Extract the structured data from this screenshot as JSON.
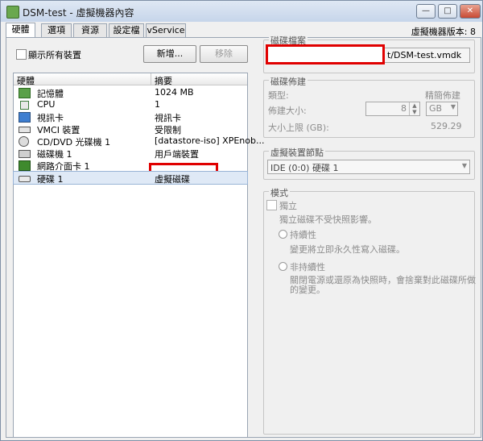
{
  "window": {
    "title": "DSM-test - 虛擬機器內容",
    "version": "虛擬機器版本: 8"
  },
  "tabs": [
    "硬體",
    "選項",
    "資源",
    "設定檔",
    "vService"
  ],
  "hardware": {
    "show_all_label": "顯示所有裝置",
    "add_label": "新增...",
    "remove_label": "移除",
    "col_hardware": "硬體",
    "col_summary": "摘要",
    "items": [
      {
        "icon": "memory-icon",
        "name": "記憶體",
        "summary": "1024 MB"
      },
      {
        "icon": "cpu-icon",
        "name": "CPU",
        "summary": "1"
      },
      {
        "icon": "display-icon",
        "name": "視訊卡",
        "summary": "視訊卡"
      },
      {
        "icon": "vmci-icon",
        "name": "VMCI 裝置",
        "summary": "受限制"
      },
      {
        "icon": "cd-icon",
        "name": "CD/DVD 光碟機 1",
        "summary": "[datastore-iso] XPEnob..."
      },
      {
        "icon": "floppy-icon",
        "name": "磁碟機 1",
        "summary": "用戶端裝置"
      },
      {
        "icon": "nic-icon",
        "name": "網路介面卡 1",
        "summary": ""
      },
      {
        "icon": "harddisk-icon",
        "name": "硬碟 1",
        "summary": "虛擬磁碟"
      }
    ]
  },
  "disk_file": {
    "legend": "磁碟檔案",
    "value": "t/DSM-test.vmdk"
  },
  "provisioning": {
    "legend": "磁碟佈建",
    "type_label": "類型:",
    "type_value": "精簡佈建",
    "size_label": "佈建大小:",
    "size_value": "8",
    "unit": "GB",
    "max_label": "大小上限 (GB):",
    "max_value": "529.29"
  },
  "vdev": {
    "legend": "虛擬裝置節點",
    "value": "IDE (0:0) 硬碟 1"
  },
  "mode": {
    "legend": "模式",
    "independent_label": "獨立",
    "independent_desc": "獨立磁碟不受快照影響。",
    "persistent_label": "持續性",
    "persistent_desc": "變更將立即永久性寫入磁碟。",
    "nonpersistent_label": "非持續性",
    "nonpersistent_desc_1": "關閉電源或還原為快照時，會捨棄對此磁碟所做",
    "nonpersistent_desc_2": "的變更。"
  },
  "colors": {
    "redact": "#e00000",
    "selection": "#dfe9f6"
  }
}
